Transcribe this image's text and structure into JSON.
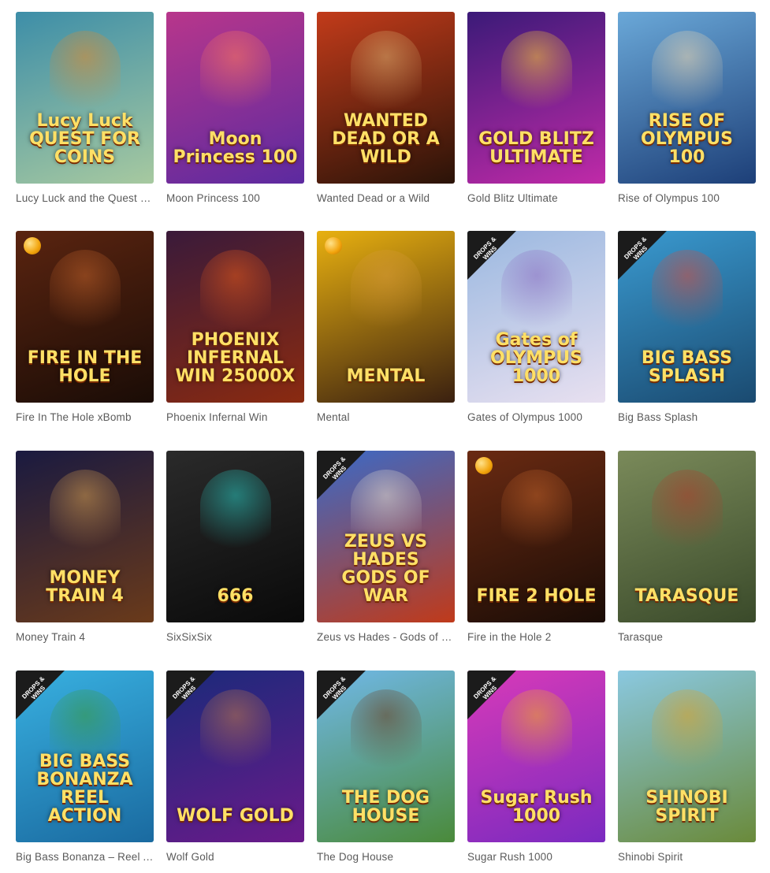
{
  "games": [
    {
      "title": "Lucy Luck and the Quest for Coins",
      "logo": "Lucy Luck QUEST FOR COINS",
      "bg": [
        "#3d8ea8",
        "#a7c9a0"
      ],
      "accent": "#e38a2b",
      "drops": false,
      "coin": false
    },
    {
      "title": "Moon Princess 100",
      "logo": "Moon Princess 100",
      "bg": [
        "#b8368b",
        "#5c2aa0"
      ],
      "accent": "#ff7a5c",
      "drops": false,
      "coin": false
    },
    {
      "title": "Wanted Dead or a Wild",
      "logo": "WANTED DEAD OR A WILD",
      "bg": [
        "#c23b1a",
        "#2a1308"
      ],
      "accent": "#d9b070",
      "drops": false,
      "coin": false
    },
    {
      "title": "Gold Blitz Ultimate",
      "logo": "GOLD BLITZ ULTIMATE",
      "bg": [
        "#3b1a78",
        "#c02aa8"
      ],
      "accent": "#ffcc33",
      "drops": false,
      "coin": false
    },
    {
      "title": "Rise of Olympus 100",
      "logo": "RISE OF OLYMPUS 100",
      "bg": [
        "#6aa8d8",
        "#1d3f78"
      ],
      "accent": "#f0d8b0",
      "drops": false,
      "coin": false
    },
    {
      "title": "Fire In The Hole xBomb",
      "logo": "FIRE IN THE HOLE",
      "bg": [
        "#5a2410",
        "#1a0c06"
      ],
      "accent": "#c0622a",
      "drops": false,
      "coin": true
    },
    {
      "title": "Phoenix Infernal Win",
      "logo": "PHOENIX INFERNAL WIN 25000X",
      "bg": [
        "#3a1a3a",
        "#8a2a10"
      ],
      "accent": "#e85a1a",
      "drops": false,
      "coin": false
    },
    {
      "title": "Mental",
      "logo": "MENTAL",
      "bg": [
        "#e8b010",
        "#3a2010"
      ],
      "accent": "#d89a3a",
      "drops": false,
      "coin": true
    },
    {
      "title": "Gates of Olympus 1000",
      "logo": "Gates of OLYMPUS 1000",
      "bg": [
        "#9ab8e0",
        "#e8e0f0"
      ],
      "accent": "#8a6ac0",
      "drops": true,
      "coin": false
    },
    {
      "title": "Big Bass Splash",
      "logo": "BIG BASS SPLASH",
      "bg": [
        "#3a9ad0",
        "#1a4a70"
      ],
      "accent": "#d84a3a",
      "drops": true,
      "coin": false
    },
    {
      "title": "Money Train 4",
      "logo": "MONEY TRAIN 4",
      "bg": [
        "#1a1a40",
        "#6a3a1a"
      ],
      "accent": "#d8a050",
      "drops": false,
      "coin": false
    },
    {
      "title": "SixSixSix",
      "logo": "666",
      "bg": [
        "#2a2a2a",
        "#0a0a0a"
      ],
      "accent": "#2ac8c0",
      "drops": false,
      "coin": false
    },
    {
      "title": "Zeus vs Hades - Gods of War",
      "logo": "ZEUS VS HADES GODS OF WAR",
      "bg": [
        "#3a6ac8",
        "#c03a1a"
      ],
      "accent": "#e8e0d0",
      "drops": true,
      "coin": false
    },
    {
      "title": "Fire in the Hole 2",
      "logo": "FIRE 2 HOLE",
      "bg": [
        "#6a2a12",
        "#1a0c06"
      ],
      "accent": "#c0622a",
      "drops": false,
      "coin": true
    },
    {
      "title": "Tarasque",
      "logo": "TARASQUE",
      "bg": [
        "#7a8a5a",
        "#3a4a2a"
      ],
      "accent": "#b03a2a",
      "drops": false,
      "coin": false
    },
    {
      "title": "Big Bass Bonanza – Reel Action",
      "logo": "BIG BASS BONANZA REEL ACTION",
      "bg": [
        "#38b0e0",
        "#1a6aa0"
      ],
      "accent": "#3a9a3a",
      "drops": true,
      "coin": false
    },
    {
      "title": "Wolf Gold",
      "logo": "WOLF GOLD",
      "bg": [
        "#1a2a7a",
        "#6a1a8a"
      ],
      "accent": "#c0784a",
      "drops": true,
      "coin": false
    },
    {
      "title": "The Dog House",
      "logo": "THE DOG HOUSE",
      "bg": [
        "#70b8e8",
        "#4a8a3a"
      ],
      "accent": "#6a3a1a",
      "drops": true,
      "coin": false
    },
    {
      "title": "Sugar Rush 1000",
      "logo": "Sugar Rush 1000",
      "bg": [
        "#d83ab8",
        "#7a2ac0"
      ],
      "accent": "#f0b020",
      "drops": true,
      "coin": false
    },
    {
      "title": "Shinobi Spirit",
      "logo": "SHINOBI SPIRIT",
      "bg": [
        "#8ac8e0",
        "#6a8a3a"
      ],
      "accent": "#e0a020",
      "drops": false,
      "coin": false
    }
  ],
  "drops_badge": "DROPS & WINS"
}
